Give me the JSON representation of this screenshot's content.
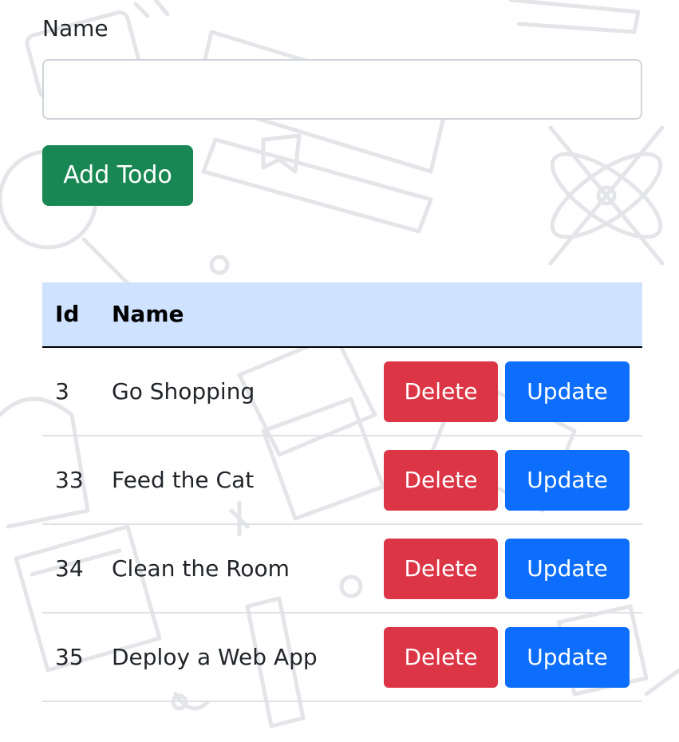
{
  "form": {
    "name_label": "Name",
    "name_value": "",
    "name_placeholder": "",
    "add_button_label": "Add Todo"
  },
  "table": {
    "headers": {
      "id": "Id",
      "name": "Name"
    },
    "rows": [
      {
        "id": "3",
        "name": "Go Shopping",
        "delete_label": "Delete",
        "update_label": "Update"
      },
      {
        "id": "33",
        "name": "Feed the Cat",
        "delete_label": "Delete",
        "update_label": "Update"
      },
      {
        "id": "34",
        "name": "Clean the Room",
        "delete_label": "Delete",
        "update_label": "Update"
      },
      {
        "id": "35",
        "name": "Deploy a Web App",
        "delete_label": "Delete",
        "update_label": "Update"
      }
    ]
  },
  "colors": {
    "add_button": "#198754",
    "delete_button": "#dc3545",
    "update_button": "#0d6efd",
    "table_header_bg": "#cfe2ff",
    "background_doodles": "#e4e5e8"
  },
  "icons": {
    "background": "school-supplies-doodle-pattern"
  }
}
